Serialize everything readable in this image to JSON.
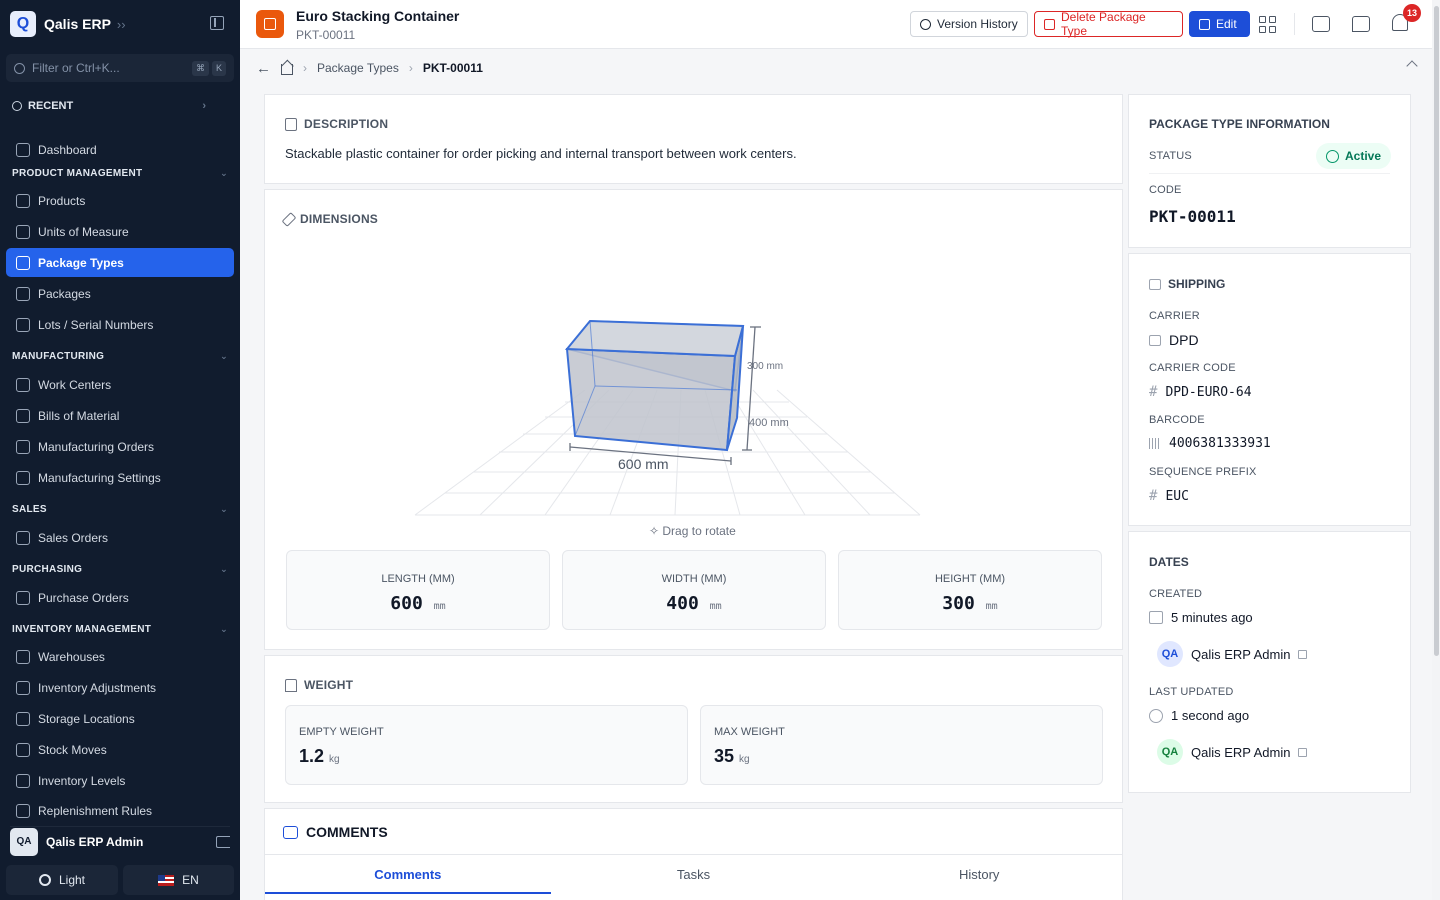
{
  "app": {
    "name": "Qalis ERP",
    "logo_letter": "Q"
  },
  "sidebar": {
    "filter_placeholder": "Filter or Ctrl+K...",
    "filter_keys": [
      "⌘",
      "K"
    ],
    "recent_label": "RECENT",
    "dashboard": "Dashboard",
    "sections": [
      {
        "label": "PRODUCT MANAGEMENT",
        "items": [
          "Products",
          "Units of Measure",
          "Package Types",
          "Packages",
          "Lots / Serial Numbers"
        ]
      },
      {
        "label": "MANUFACTURING",
        "items": [
          "Work Centers",
          "Bills of Material",
          "Manufacturing Orders",
          "Manufacturing Settings"
        ]
      },
      {
        "label": "SALES",
        "items": [
          "Sales Orders"
        ]
      },
      {
        "label": "PURCHASING",
        "items": [
          "Purchase Orders"
        ]
      },
      {
        "label": "INVENTORY MANAGEMENT",
        "items": [
          "Warehouses",
          "Inventory Adjustments",
          "Storage Locations",
          "Stock Moves",
          "Inventory Levels",
          "Replenishment Rules"
        ]
      }
    ],
    "active_item": "Package Types",
    "user": {
      "initials": "QA",
      "name": "Qalis ERP Admin"
    },
    "theme_label": "Light",
    "lang_label": "EN"
  },
  "header": {
    "title": "Euro Stacking Container",
    "subtitle": "PKT-00011",
    "version_history": "Version History",
    "delete": "Delete Package Type",
    "edit": "Edit",
    "notification_count": "13"
  },
  "breadcrumb": {
    "parent": "Package Types",
    "current": "PKT-00011"
  },
  "description": {
    "heading": "DESCRIPTION",
    "text": "Stackable plastic container for order picking and internal transport between work centers."
  },
  "dimensions": {
    "heading": "DIMENSIONS",
    "viewer_labels": {
      "length": "600 mm",
      "width": "400 mm",
      "height": "300 mm"
    },
    "drag_hint": "Drag to rotate",
    "length": {
      "label": "LENGTH (MM)",
      "value": "600",
      "unit": "mm"
    },
    "width": {
      "label": "WIDTH (MM)",
      "value": "400",
      "unit": "mm"
    },
    "height": {
      "label": "HEIGHT (MM)",
      "value": "300",
      "unit": "mm"
    }
  },
  "weight": {
    "heading": "WEIGHT",
    "empty": {
      "label": "EMPTY WEIGHT",
      "value": "1.2",
      "unit": "kg"
    },
    "max": {
      "label": "MAX WEIGHT",
      "value": "35",
      "unit": "kg"
    }
  },
  "comments": {
    "heading": "COMMENTS",
    "tabs": [
      "Comments",
      "Tasks",
      "History"
    ],
    "active_tab": "Comments"
  },
  "info": {
    "heading": "PACKAGE TYPE INFORMATION",
    "status_label": "STATUS",
    "status_value": "Active",
    "code_label": "CODE",
    "code_value": "PKT-00011"
  },
  "shipping": {
    "heading": "SHIPPING",
    "carrier_label": "CARRIER",
    "carrier_value": "DPD",
    "carrier_code_label": "CARRIER CODE",
    "carrier_code_value": "DPD-EURO-64",
    "barcode_label": "BARCODE",
    "barcode_value": "4006381333931",
    "prefix_label": "SEQUENCE PREFIX",
    "prefix_value": "EUC"
  },
  "dates": {
    "heading": "DATES",
    "created_label": "CREATED",
    "created_value": "5 minutes ago",
    "created_by": "Qalis ERP Admin",
    "created_initials": "QA",
    "updated_label": "LAST UPDATED",
    "updated_value": "1 second ago",
    "updated_by": "Qalis ERP Admin",
    "updated_initials": "QA"
  },
  "colors": {
    "accent": "#2563eb",
    "sidebar_bg": "#111c2e",
    "danger": "#dc2626",
    "success": "#047857",
    "brand_orange": "#ea580c"
  }
}
